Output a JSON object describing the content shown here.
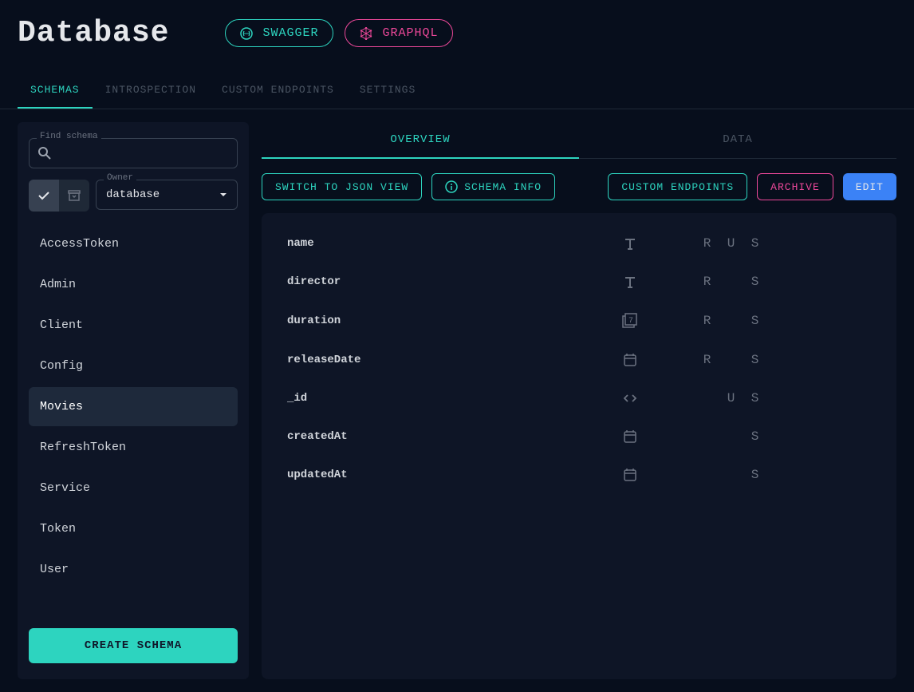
{
  "header": {
    "title": "Database",
    "swagger_label": "SWAGGER",
    "graphql_label": "GRAPHQL"
  },
  "topTabs": [
    {
      "label": "SCHEMAS",
      "active": true
    },
    {
      "label": "INTROSPECTION",
      "active": false
    },
    {
      "label": "CUSTOM ENDPOINTS",
      "active": false
    },
    {
      "label": "SETTINGS",
      "active": false
    }
  ],
  "sidebar": {
    "searchLabel": "Find schema",
    "ownerLabel": "Owner",
    "ownerValue": "database",
    "schemas": [
      {
        "name": "AccessToken",
        "selected": false
      },
      {
        "name": "Admin",
        "selected": false
      },
      {
        "name": "Client",
        "selected": false
      },
      {
        "name": "Config",
        "selected": false
      },
      {
        "name": "Movies",
        "selected": true
      },
      {
        "name": "RefreshToken",
        "selected": false
      },
      {
        "name": "Service",
        "selected": false
      },
      {
        "name": "Token",
        "selected": false
      },
      {
        "name": "User",
        "selected": false
      }
    ],
    "createBtn": "CREATE SCHEMA"
  },
  "contentTabs": [
    {
      "label": "OVERVIEW",
      "active": true
    },
    {
      "label": "DATA",
      "active": false
    }
  ],
  "actions": {
    "switchView": "SWITCH TO JSON VIEW",
    "schemaInfo": "SCHEMA INFO",
    "customEndpoints": "CUSTOM ENDPOINTS",
    "archive": "ARCHIVE",
    "edit": "EDIT"
  },
  "fields": [
    {
      "name": "name",
      "type": "text",
      "flags": [
        "R",
        "U",
        "S"
      ]
    },
    {
      "name": "director",
      "type": "text",
      "flags": [
        "R",
        "",
        "S"
      ]
    },
    {
      "name": "duration",
      "type": "number",
      "flags": [
        "R",
        "",
        "S"
      ]
    },
    {
      "name": "releaseDate",
      "type": "date",
      "flags": [
        "R",
        "",
        "S"
      ]
    },
    {
      "name": "_id",
      "type": "code",
      "flags": [
        "",
        "U",
        "S"
      ]
    },
    {
      "name": "createdAt",
      "type": "date",
      "flags": [
        "",
        "",
        "S"
      ]
    },
    {
      "name": "updatedAt",
      "type": "date",
      "flags": [
        "",
        "",
        "S"
      ]
    }
  ]
}
